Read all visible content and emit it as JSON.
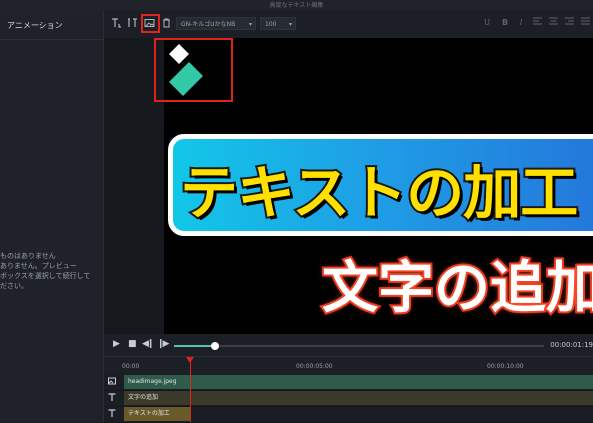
{
  "window": {
    "title": "高度なテキスト編集"
  },
  "sidebar": {
    "title": "アニメーション",
    "message_lines": [
      "ものはありません",
      "ありません。プレビュー",
      "ボックスを選択して続行して",
      "ださい。"
    ]
  },
  "toolbar": {
    "icons": [
      "text-tool-icon",
      "vertical-text-icon",
      "image-icon",
      "delete-icon"
    ],
    "font_name": "GN-キルゴUかなNB",
    "font_size": "100",
    "format_buttons": [
      "U",
      "B",
      "I"
    ]
  },
  "preview": {
    "headline": "テキストの加工",
    "subheadline": "文字の追加",
    "colors": {
      "highlight": "#e0241b",
      "headline_fill": "#ffe000",
      "banner_start": "#12c7e8",
      "banner_end": "#2570d9",
      "logo_teal": "#34c9a6"
    }
  },
  "playbar": {
    "timecode": "00:00:01:19",
    "progress": 0.11
  },
  "timeline": {
    "ticks": [
      "00:00",
      "00:00:05:00",
      "00:00:10:00"
    ],
    "tracks": [
      {
        "icon": "image-track-icon",
        "name": "headimage.jpeg",
        "color": "#2e5b4a"
      },
      {
        "icon": "text-track-icon",
        "name": "文字の追加",
        "color": "#3b3a2a"
      },
      {
        "icon": "text-track-icon",
        "name": "テキストの加工",
        "color": "#6a5a2a"
      }
    ]
  }
}
